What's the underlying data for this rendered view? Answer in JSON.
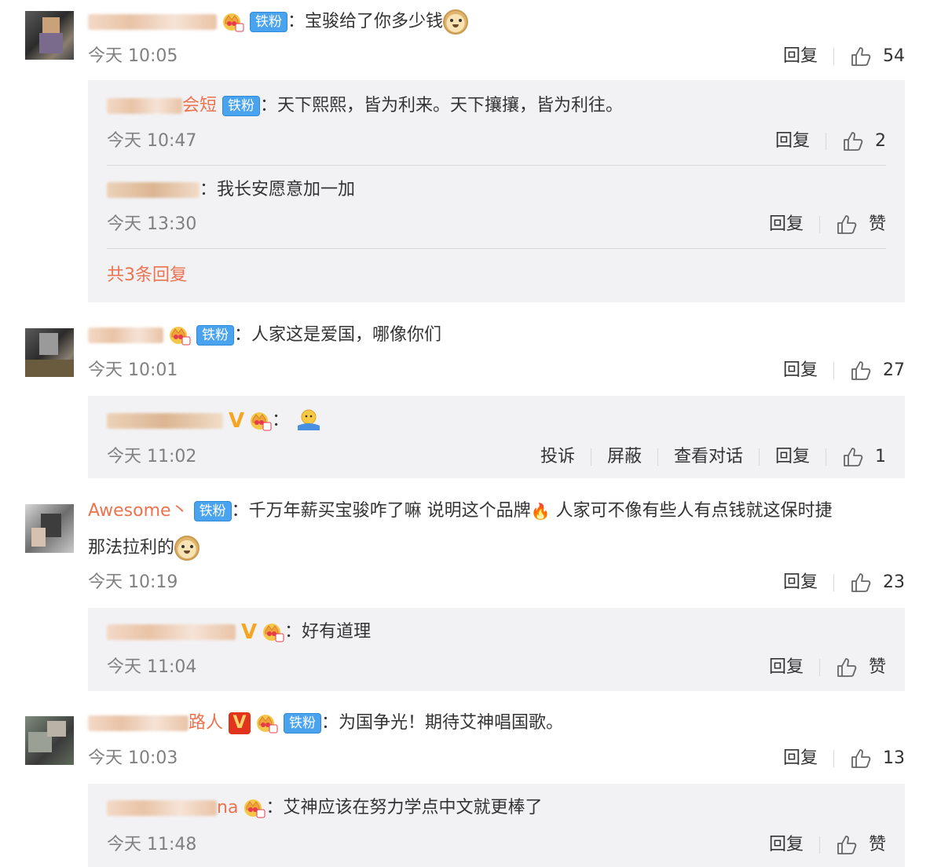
{
  "colors": {
    "username": "#eb7350",
    "fan_badge": "#4aa3ee",
    "reply_bg": "#f2f2f5",
    "meta": "#808080"
  },
  "labels": {
    "fan_badge": "铁粉",
    "reply": "回复",
    "report": "投诉",
    "block": "屏蔽",
    "view_conversation": "查看对话",
    "like": "赞"
  },
  "comments": [
    {
      "text": "：宝骏给了你多少钱",
      "time": "今天 10:05",
      "likes": "54",
      "replies": [
        {
          "name": "会短",
          "text": "：天下熙熙，皆为利来。天下攘攘，皆为利往。",
          "time": "今天 10:47",
          "likes": "2"
        },
        {
          "name": "",
          "text": "：我长安愿意加一加",
          "time": "今天 13:30",
          "likes": "赞"
        }
      ],
      "more_replies": "共3条回复"
    },
    {
      "text": "：人家这是爱国，哪像你们",
      "time": "今天 10:01",
      "likes": "27",
      "replies": [
        {
          "name": "",
          "text": "：",
          "time": "今天 11:02",
          "likes": "1"
        }
      ]
    },
    {
      "name": "Awesome丶",
      "text_part1": "：千万年薪买宝骏咋了嘛 说明这个品牌",
      "text_part2": " 人家可不像有些人有点钱就这保时捷",
      "text_line2": "那法拉利的",
      "time": "今天 10:19",
      "likes": "23",
      "replies": [
        {
          "name": "",
          "text": "：好有道理",
          "time": "今天 11:04",
          "likes": "赞"
        }
      ]
    },
    {
      "name": "路人",
      "text": "：为国争光！期待艾神唱国歌。",
      "time": "今天 10:03",
      "likes": "13",
      "replies": [
        {
          "name": "na",
          "text": "：艾神应该在努力学点中文就更棒了",
          "time": "今天 11:48",
          "likes": "赞"
        }
      ]
    }
  ]
}
